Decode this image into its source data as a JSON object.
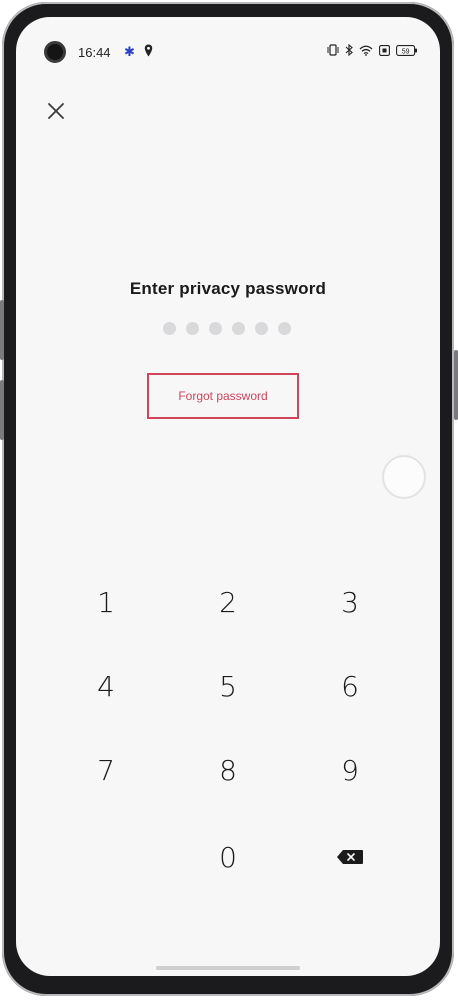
{
  "status_bar": {
    "time": "16:44",
    "battery_level": "59"
  },
  "screen": {
    "title": "Enter privacy password",
    "pin_length": 6,
    "forgot_label": "Forgot password"
  },
  "keypad": {
    "keys": [
      "1",
      "2",
      "3",
      "4",
      "5",
      "6",
      "7",
      "8",
      "9",
      "0"
    ]
  },
  "colors": {
    "accent": "#d0455a",
    "background": "#f7f7f8",
    "text": "#1a1a1a"
  },
  "icons": {
    "close": "close-icon",
    "backspace": "backspace-icon",
    "settings": "gear-icon",
    "location": "location-icon"
  }
}
